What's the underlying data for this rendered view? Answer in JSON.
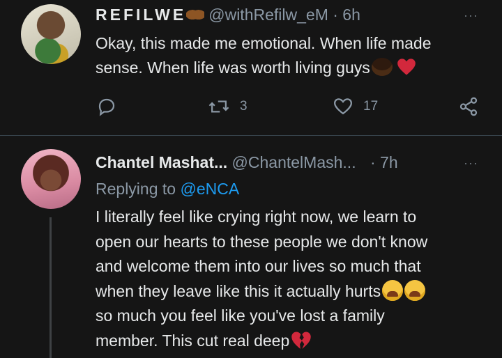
{
  "tweet1": {
    "display_name": "REFILWE",
    "handle_time": "@withRefilw_eM · 6h",
    "more_label": "···",
    "line1": "Okay, this made me emotional. When life made",
    "line2": "sense. When life was worth living guys",
    "actions": {
      "reply_count": "",
      "retweet_count": "3",
      "like_count": "17"
    },
    "icons": [
      "raised-hands-icon",
      "face-emoji-icon",
      "red-heart-icon",
      "reply-icon",
      "retweet-icon",
      "like-icon",
      "share-icon"
    ]
  },
  "tweet2": {
    "display_name": "Chantel Mashat...",
    "handle": "@ChantelMash...",
    "time": "· 7h",
    "more_label": "···",
    "replying_prefix": "Replying to",
    "replying_mention": "@eNCA",
    "lines": [
      "I literally feel like crying right now, we learn to",
      "open our hearts to these people we don't know",
      "and welcome them into our lives so much that",
      "when they leave like this it actually hurts",
      "so much you feel like you've lost a family",
      "member. This cut real deep"
    ],
    "icons": [
      "crying-face-icon",
      "broken-heart-icon"
    ]
  },
  "colors": {
    "background": "#151515",
    "text": "#e7e9ea",
    "muted": "#8b98a5",
    "link": "#1d9bf0",
    "divider": "#38444d"
  }
}
